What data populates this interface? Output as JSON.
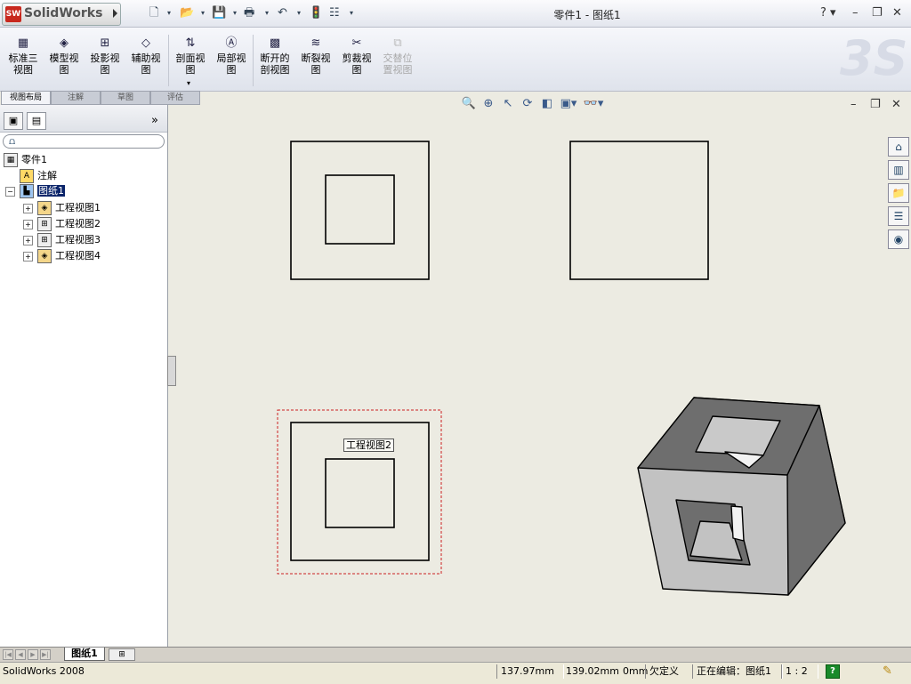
{
  "app": {
    "logo_badge": "SW",
    "name": "SolidWorks"
  },
  "window": {
    "title": "零件1 - 图纸1"
  },
  "quick_access": {
    "new": "🗋",
    "open": "📂",
    "save": "💾",
    "print": "🖶",
    "undo": "↶",
    "rebuild": "🚦",
    "options": "☷"
  },
  "window_buttons": {
    "help": "? ▾",
    "minimize": "–",
    "restore": "❐",
    "close": "✕"
  },
  "ribbon": {
    "buttons": [
      {
        "label": "标准三\n视图",
        "icon": "standard-3-view-icon",
        "glyph": "▦"
      },
      {
        "label": "模型视\n图",
        "icon": "model-view-icon",
        "glyph": "◈"
      },
      {
        "label": "投影视\n图",
        "icon": "projected-view-icon",
        "glyph": "⊞"
      },
      {
        "label": "辅助视\n图",
        "icon": "auxiliary-view-icon",
        "glyph": "◇"
      },
      {
        "label": "剖面视\n图",
        "icon": "section-view-icon",
        "glyph": "⇅"
      },
      {
        "label": "局部视\n图",
        "icon": "detail-view-icon",
        "glyph": "Ⓐ"
      },
      {
        "label": "断开的\n剖视图",
        "icon": "broken-out-section-icon",
        "glyph": "▩"
      },
      {
        "label": "断裂视\n图",
        "icon": "break-view-icon",
        "glyph": "≋"
      },
      {
        "label": "剪裁视\n图",
        "icon": "crop-view-icon",
        "glyph": "✂"
      },
      {
        "label": "交替位\n置视图",
        "icon": "alternate-position-icon",
        "glyph": "⧉",
        "disabled": true
      }
    ],
    "tabs": [
      "视图布局",
      "注解",
      "草图",
      "评估"
    ],
    "active_tab": "视图布局",
    "watermark": "3S"
  },
  "feature_tree": {
    "panel_tabs": [
      "▣",
      "▤"
    ],
    "expand_glyph": "»",
    "filter_glyph": "⩍",
    "root": "零件1",
    "annotations": "注解",
    "sheet": "图纸1",
    "views": [
      "工程视图1",
      "工程视图2",
      "工程视图3",
      "工程视图4"
    ]
  },
  "graphics": {
    "hover_label": "工程视图2",
    "view_toolbar": [
      "🔍",
      "⊕",
      "↖",
      "⟳",
      "◧",
      "▣▾",
      "👓▾"
    ],
    "task_pane_icons": [
      "⌂",
      "▥",
      "📁",
      "☰",
      "◉"
    ],
    "colors": {
      "selection": "#cc2222",
      "face_dark": "#6e6e6e",
      "face_light": "#c2c2c2",
      "face_hole": "#e2e2e2",
      "background": "#ecebe2"
    }
  },
  "sheet_tabs": {
    "nav": [
      "|◀",
      "◀",
      "▶",
      "▶|"
    ],
    "active": "图纸1",
    "add_glyph": "⊞"
  },
  "status": {
    "app": "SolidWorks 2008",
    "x": "137.97mm",
    "y": "139.02mm",
    "z": "0mm",
    "defined": "欠定义",
    "editing": "正在编辑：图纸1",
    "scale": "1 : 2",
    "help_glyph": "?",
    "pin_glyph": "✎"
  }
}
